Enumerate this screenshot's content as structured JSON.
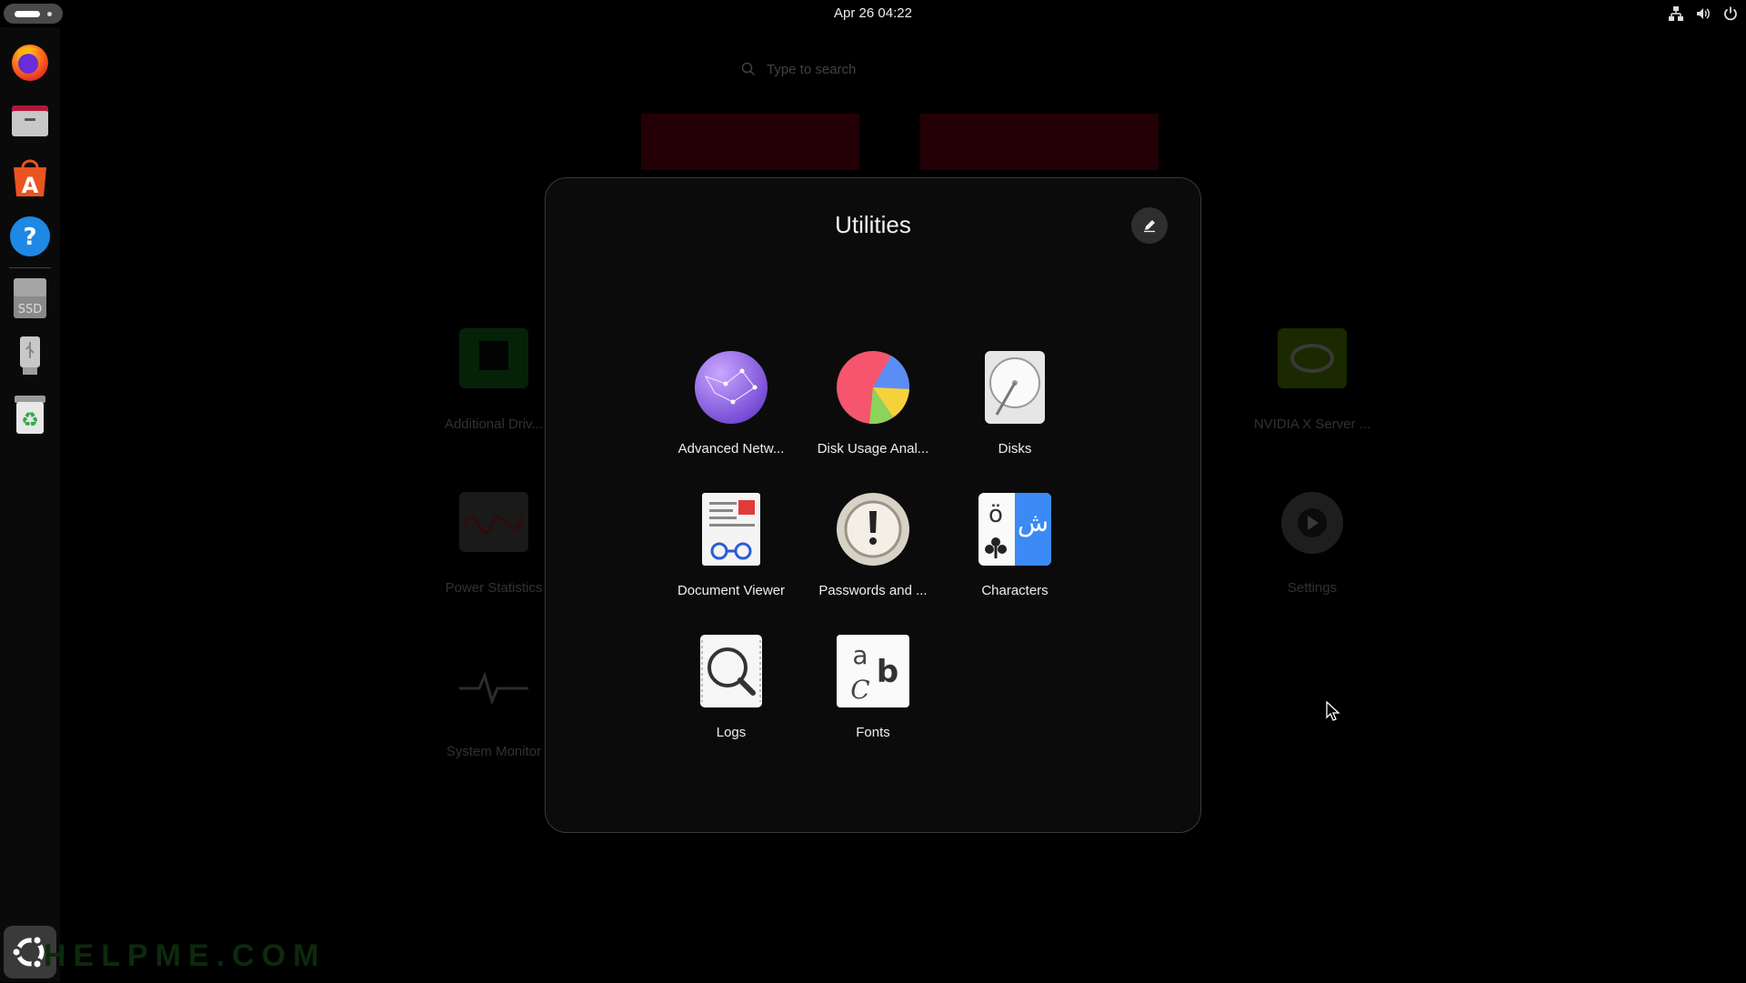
{
  "topbar": {
    "clock": "Apr 26  04:22",
    "tray_icons": [
      "network-icon",
      "volume-icon",
      "power-icon"
    ]
  },
  "dock": {
    "items": [
      {
        "name": "firefox",
        "icon": "firefox-icon"
      },
      {
        "name": "files",
        "icon": "files-icon"
      },
      {
        "name": "app-center",
        "icon": "app-center-icon"
      },
      {
        "name": "help",
        "icon": "help-icon",
        "glyph": "?"
      },
      {
        "name": "ssd-drive",
        "icon": "ssd-drive-icon",
        "label": "SSD"
      },
      {
        "name": "usb-drive",
        "icon": "usb-drive-icon"
      },
      {
        "name": "trash",
        "icon": "trash-icon",
        "glyph": "♻"
      },
      {
        "name": "show-apps",
        "icon": "ubuntu-icon"
      }
    ]
  },
  "search": {
    "placeholder": "Type to search"
  },
  "background_apps": [
    {
      "label": "Additional Driv...",
      "icon": "additional-drivers-icon"
    },
    {
      "label": "Power Statistics",
      "icon": "power-statistics-icon"
    },
    {
      "label": "System Monitor",
      "icon": "system-monitor-icon"
    },
    {
      "label": "NVIDIA X Server ...",
      "icon": "nvidia-icon"
    },
    {
      "label": "Settings",
      "icon": "settings-icon"
    }
  ],
  "folder": {
    "title": "Utilities",
    "apps": [
      {
        "label": "Advanced Netw...",
        "icon": "network-globe-icon"
      },
      {
        "label": "Disk Usage Anal...",
        "icon": "disk-usage-pie-icon"
      },
      {
        "label": "Disks",
        "icon": "disks-icon"
      },
      {
        "label": "Document Viewer",
        "icon": "document-viewer-icon"
      },
      {
        "label": "Passwords and ...",
        "icon": "passwords-keyhole-icon"
      },
      {
        "label": "Characters",
        "icon": "characters-icon",
        "glyphs": [
          "ö",
          "ش"
        ]
      },
      {
        "label": "Logs",
        "icon": "logs-magnifier-icon"
      },
      {
        "label": "Fonts",
        "icon": "fonts-icon",
        "glyphs": [
          "a",
          "b",
          "C"
        ]
      }
    ]
  },
  "watermark": "HELPME.COM"
}
